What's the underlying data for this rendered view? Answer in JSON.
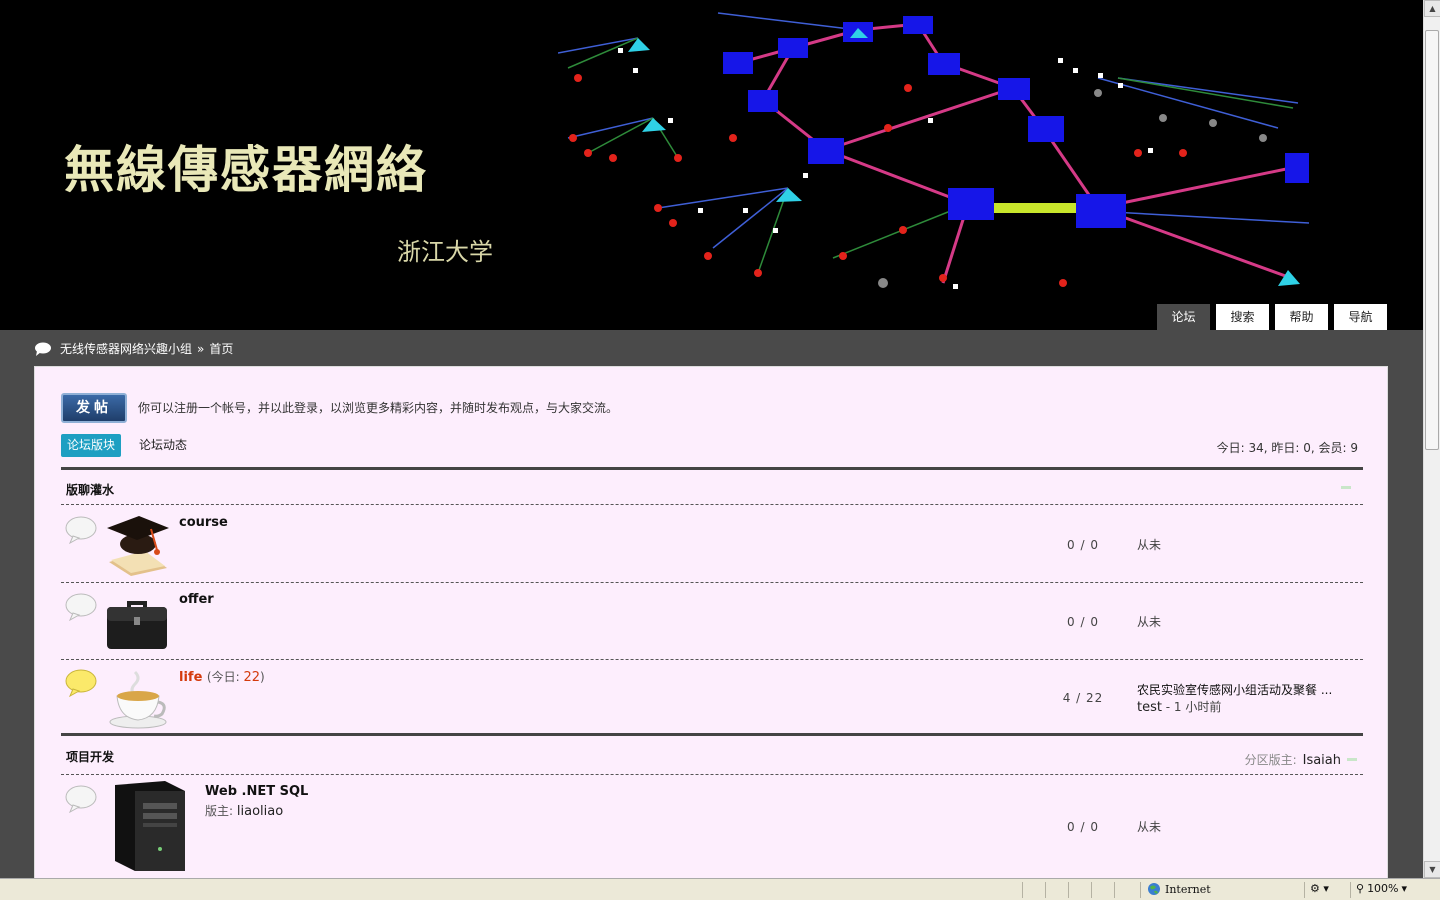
{
  "header": {
    "site_title": "無線傳感器網絡",
    "site_subtitle": "浙江大学",
    "nav": [
      {
        "label": "论坛",
        "active": true
      },
      {
        "label": "搜索",
        "active": false
      },
      {
        "label": "帮助",
        "active": false
      },
      {
        "label": "导航",
        "active": false
      }
    ]
  },
  "breadcrumb": {
    "home": "无线传感器网络兴趣小组",
    "sep": "»",
    "current": "首页"
  },
  "main": {
    "post_button": "发帖",
    "notice": "你可以注册一个帐号，并以此登录，以浏览更多精彩内容，并随时发布观点，与大家交流。",
    "tabs": [
      {
        "label": "论坛版块",
        "active": true
      },
      {
        "label": "论坛动态",
        "active": false
      }
    ],
    "stats": "今日: 34, 昨日: 0, 会员: 9"
  },
  "groups": [
    {
      "title": "版聊灌水",
      "forums": [
        {
          "name": "course",
          "counts": "0 / 0",
          "last": "从未",
          "icon": "graduation-cap-icon"
        },
        {
          "name": "offer",
          "counts": "0 / 0",
          "last": "从未",
          "icon": "briefcase-icon"
        },
        {
          "name": "life",
          "today_label": "(今日:",
          "today_count": "22",
          "today_close": ")",
          "counts": "4 / 22",
          "last_title": "农民实验室传感网小组活动及聚餐 ...",
          "last_user": "test",
          "last_time": " - 1 小时前",
          "icon": "coffee-cup-icon"
        }
      ]
    },
    {
      "title": "项目开发",
      "moderator_label": "分区版主:",
      "moderator": "Isaiah",
      "forums": [
        {
          "name": "Web .NET SQL",
          "mod_label": "版主:",
          "mod": "liaoliao",
          "counts": "0 / 0",
          "last": "从未",
          "icon": "server-tower-icon"
        }
      ]
    }
  ],
  "statusbar": {
    "zone": "Internet",
    "zoom": "100%"
  },
  "colors": {
    "accent": "#1e9fc2",
    "hot": "#d43a0c",
    "panel_bg": "#fdeefd",
    "header_bg": "#000000"
  }
}
